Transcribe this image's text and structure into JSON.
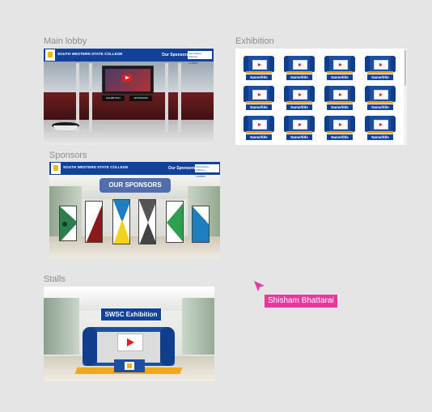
{
  "frames": {
    "main_lobby": {
      "label": "Main  lobby",
      "college": "SOUTH WESTERN STATE COLLEGE",
      "sponsors_link": "Our Sponsors",
      "contact_line1": "Somewhere, Address",
      "contact_line2": "Contact No: 01-1235556",
      "sign_left": "EXHIBITION",
      "sign_right": "SPONSORS"
    },
    "exhibition": {
      "label": "Exhibition",
      "booth_label": "Name/title",
      "booth_count": 12
    },
    "sponsors": {
      "label": "Sponsors",
      "college": "SOUTH WESTERN STATE COLLEGE",
      "sponsors_link": "Our Sponsors",
      "contact_line1": "Somewhere, Address",
      "contact_line2": "Contact No: 01-1235556",
      "title": "OUR SPONSORS"
    },
    "stalls": {
      "label": "Stalls",
      "title": "SWSC Exhibition"
    }
  },
  "collaborator": {
    "name": "Shisham Bhattarai",
    "color": "#e8389e"
  },
  "colors": {
    "brand_blue": "#12419a",
    "accent_orange": "#f2a918",
    "play_red": "#e02020"
  }
}
